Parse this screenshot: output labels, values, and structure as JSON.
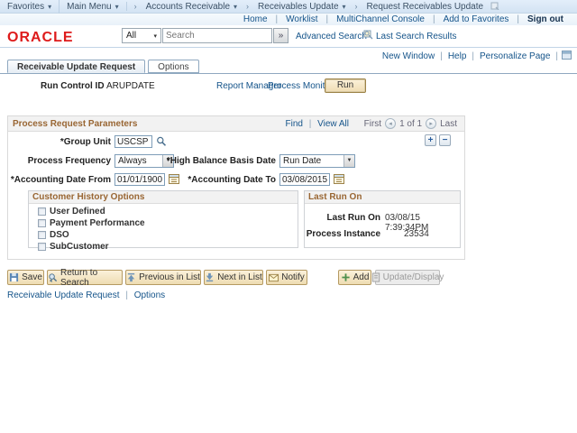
{
  "icons": {
    "dropdown_arrow": "▾",
    "crumb_sep": "›",
    "search_go": "»",
    "select_arrow": "▼",
    "prev_page": "◂",
    "next_page": "▸",
    "plus": "+",
    "minus": "−",
    "pipe": "|"
  },
  "colors": {
    "link_blue": "#15548a",
    "oracle_red": "#de1b1b",
    "section_orange": "#996633",
    "button_tan": "#f3e2bd"
  },
  "breadcrumb": {
    "favorites": "Favorites",
    "main_menu": "Main Menu",
    "crumbs": [
      "Accounts Receivable",
      "Receivables Update",
      "Request Receivables Update"
    ]
  },
  "utility": {
    "links": [
      "Home",
      "Worklist",
      "MultiChannel Console",
      "Add to Favorites"
    ],
    "sign_out": "Sign out"
  },
  "logo": "ORACLE",
  "search": {
    "scope": "All",
    "placeholder": "Search",
    "advanced": "Advanced Search",
    "last_results": "Last Search Results"
  },
  "page_links": [
    "New Window",
    "Help",
    "Personalize Page"
  ],
  "tabs": [
    {
      "label": "Receivable Update Request"
    },
    {
      "label": "Options"
    }
  ],
  "run_control": {
    "label": "Run Control ID",
    "value": "ARUPDATE",
    "report_manager": "Report Manager",
    "process_monitor": "Process Monitor",
    "run": "Run"
  },
  "section": {
    "title": "Process Request Parameters",
    "find": "Find",
    "view_all": "View All",
    "first": "First",
    "page": "1 of 1",
    "last": "Last",
    "group_unit_label": "*Group Unit",
    "group_unit_value": "USCSP",
    "process_frequency_label": "Process Frequency",
    "process_frequency_value": "Always",
    "high_balance_label": "*High Balance Basis Date",
    "high_balance_value": "Run Date",
    "acct_from_label": "*Accounting Date From",
    "acct_from_value": "01/01/1900",
    "acct_to_label": "*Accounting Date To",
    "acct_to_value": "03/08/2015"
  },
  "customer_history": {
    "title": "Customer History Options",
    "options": [
      "User Defined",
      "Payment Performance",
      "DSO",
      "SubCustomer"
    ]
  },
  "last_run": {
    "title": "Last Run On",
    "label": "Last Run On",
    "value": "03/08/15  7:39:34PM",
    "instance_label": "Process Instance",
    "instance_value": "23534"
  },
  "toolbar": {
    "save": "Save",
    "return_to_search": "Return to Search",
    "previous": "Previous in List",
    "next": "Next in List",
    "notify": "Notify",
    "add": "Add",
    "update": "Update/Display"
  },
  "footer": {
    "links": [
      "Receivable Update Request",
      "Options"
    ]
  }
}
